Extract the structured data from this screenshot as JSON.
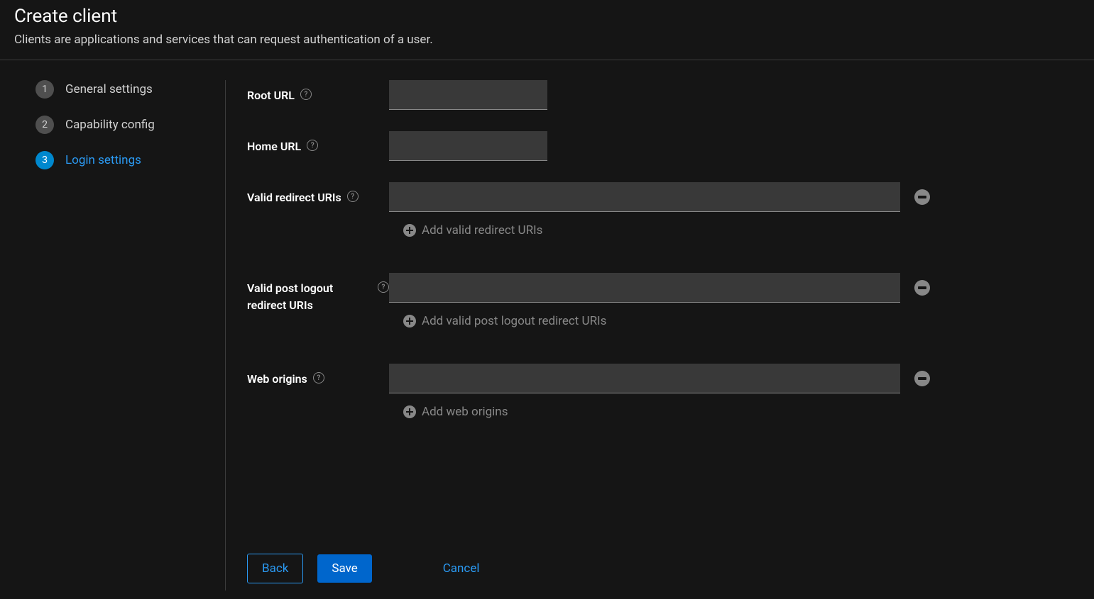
{
  "header": {
    "title": "Create client",
    "description": "Clients are applications and services that can request authentication of a user."
  },
  "steps": [
    {
      "num": "1",
      "label": "General settings",
      "state": "completed"
    },
    {
      "num": "2",
      "label": "Capability config",
      "state": "completed"
    },
    {
      "num": "3",
      "label": "Login settings",
      "state": "active"
    }
  ],
  "form": {
    "root_url": {
      "label": "Root URL",
      "value": ""
    },
    "home_url": {
      "label": "Home URL",
      "value": ""
    },
    "redirect_uris": {
      "label": "Valid redirect URIs",
      "value": "",
      "add_label": "Add valid redirect URIs"
    },
    "post_logout_uris": {
      "label": "Valid post logout redirect URIs",
      "value": "",
      "add_label": "Add valid post logout redirect URIs"
    },
    "web_origins": {
      "label": "Web origins",
      "value": "",
      "add_label": "Add web origins"
    }
  },
  "actions": {
    "back": "Back",
    "save": "Save",
    "cancel": "Cancel"
  }
}
